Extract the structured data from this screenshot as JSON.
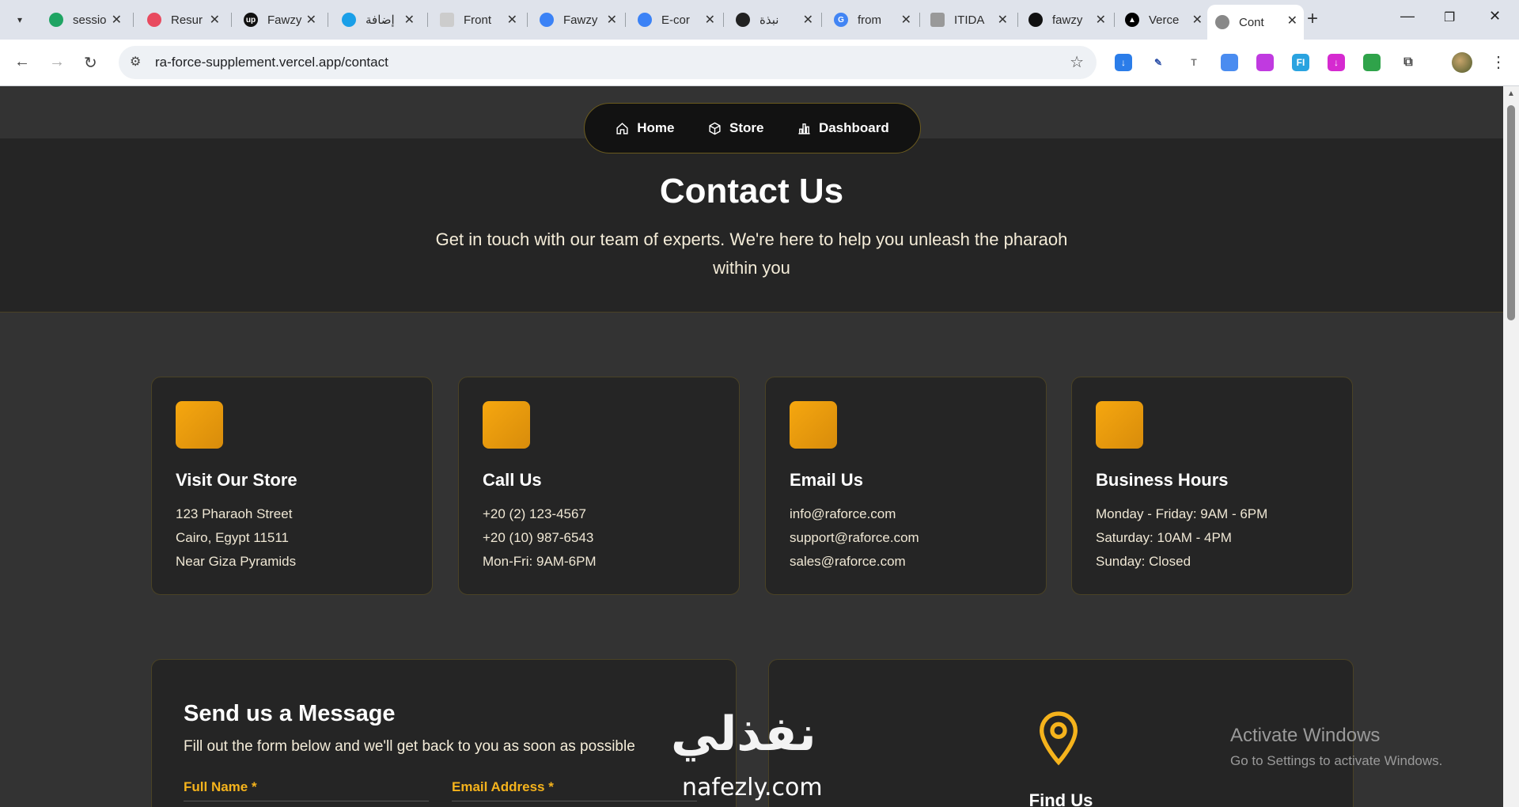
{
  "browser": {
    "tabs": [
      {
        "title": "sessio",
        "icon": "google-drive-icon",
        "color": "#1fa463"
      },
      {
        "title": "Resur",
        "icon": "resume-icon",
        "color": "#e84a5f"
      },
      {
        "title": "Fawzy",
        "icon": "upwork-icon",
        "color": "#111111"
      },
      {
        "title": "إضافة",
        "icon": "circle-icon",
        "color": "#1a9fe8"
      },
      {
        "title": "Front",
        "icon": "page-icon",
        "color": "#cccccc"
      },
      {
        "title": "Fawzy",
        "icon": "arrow-logo-icon",
        "color": "#3b82f6"
      },
      {
        "title": "E-cor",
        "icon": "arrow-logo-icon",
        "color": "#3b82f6"
      },
      {
        "title": "نبذة",
        "icon": "openai-icon",
        "color": "#222222"
      },
      {
        "title": "from",
        "icon": "google-icon",
        "color": "#4285f4"
      },
      {
        "title": "ITIDA",
        "icon": "itida-icon",
        "color": "#999999"
      },
      {
        "title": "fawzy",
        "icon": "github-icon",
        "color": "#111111"
      },
      {
        "title": "Verce",
        "icon": "vercel-icon",
        "color": "#000000"
      },
      {
        "title": "Cont",
        "icon": "globe-icon",
        "color": "#888888",
        "active": true
      }
    ],
    "url": "ra-force-supplement.vercel.app/contact"
  },
  "nav": {
    "home": "Home",
    "store": "Store",
    "dashboard": "Dashboard"
  },
  "hero": {
    "title": "Contact Us",
    "subtitle": "Get in touch with our team of experts. We're here to help you unleash the pharaoh within you"
  },
  "cards": [
    {
      "title": "Visit Our Store",
      "lines": [
        "123 Pharaoh Street",
        "Cairo, Egypt 11511",
        "Near Giza Pyramids"
      ]
    },
    {
      "title": "Call Us",
      "lines": [
        "+20 (2) 123-4567",
        "+20 (10) 987-6543",
        "Mon-Fri: 9AM-6PM"
      ]
    },
    {
      "title": "Email Us",
      "lines": [
        "info@raforce.com",
        "support@raforce.com",
        "sales@raforce.com"
      ]
    },
    {
      "title": "Business Hours",
      "lines": [
        "Monday - Friday: 9AM - 6PM",
        "Saturday: 10AM - 4PM",
        "Sunday: Closed"
      ]
    }
  ],
  "form": {
    "title": "Send us a Message",
    "subtitle": "Fill out the form below and we'll get back to you as soon as possible",
    "full_name_label": "Full Name *",
    "email_label": "Email Address *"
  },
  "map": {
    "title": "Find Us"
  },
  "overlay": {
    "watermark_ar": "نفذلي",
    "watermark_en": "nafezly.com",
    "activate_title": "Activate Windows",
    "activate_sub": "Go to Settings to activate Windows."
  },
  "colors": {
    "accent": "#f5a70f",
    "background": "#333333",
    "card": "#252525"
  }
}
